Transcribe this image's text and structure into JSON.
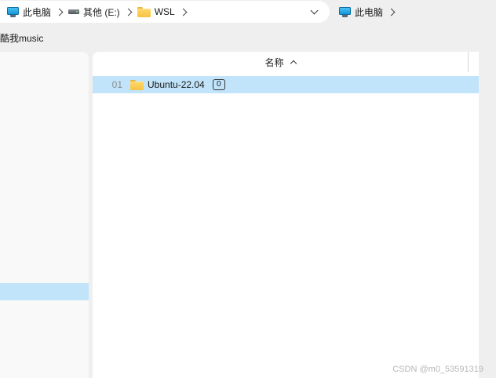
{
  "breadcrumb": {
    "items": [
      {
        "label": "此电脑",
        "icon": "computer-icon"
      },
      {
        "label": "其他 (E:)",
        "icon": "drive-icon"
      },
      {
        "label": "WSL",
        "icon": "folder-icon"
      }
    ]
  },
  "breadcrumb_right": {
    "items": [
      {
        "label": "此电脑",
        "icon": "computer-icon"
      }
    ]
  },
  "subbar": {
    "text": "酷我music"
  },
  "file_list": {
    "column_header": "名称",
    "sort": "ascending",
    "rows": [
      {
        "index": "01",
        "name": "Ubuntu-22.04",
        "badge": "0",
        "icon": "folder-icon",
        "selected": true
      }
    ]
  },
  "watermark": {
    "text": "CSDN @m0_53591319"
  },
  "colors": {
    "window_bg": "#efefef",
    "pane_bg": "#ffffff",
    "nav_bg": "#f9f9f9",
    "selection": "#c2e4fa",
    "folder_yellow": "#f6c343",
    "pc_blue": "#1596d6"
  }
}
